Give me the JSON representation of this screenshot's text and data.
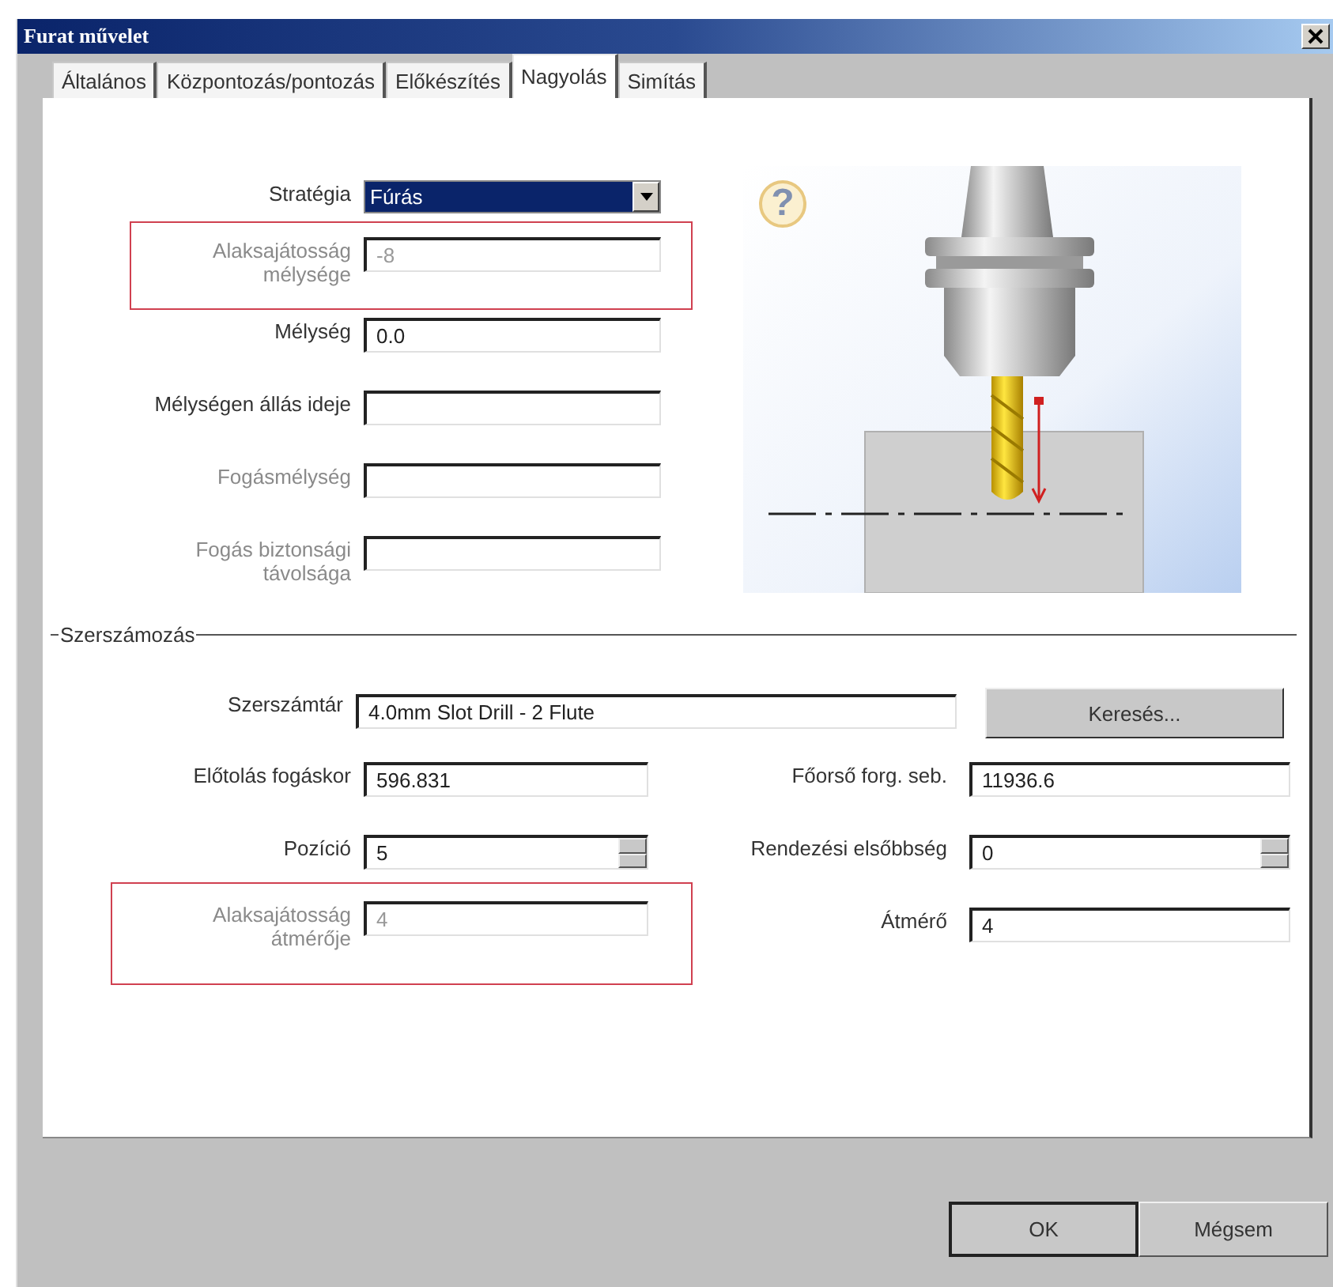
{
  "window": {
    "title": "Furat művelet"
  },
  "tabs": [
    {
      "label": "Általános",
      "selected": false
    },
    {
      "label": "Központozás/pontozás",
      "selected": false
    },
    {
      "label": "Előkészítés",
      "selected": false
    },
    {
      "label": "Nagyolás",
      "selected": true
    },
    {
      "label": "Simítás",
      "selected": false
    }
  ],
  "help_glyph": "?",
  "fields": [
    {
      "kind": "dropdown",
      "label": "Stratégia",
      "value": "Fúrás",
      "disabled": false,
      "highlighted": false
    },
    {
      "kind": "text",
      "label": "Alaksajátosság\nmélysége",
      "value": "-8",
      "disabled": true,
      "highlighted": true
    },
    {
      "kind": "text",
      "label": "Mélység",
      "value": "0.0",
      "disabled": false,
      "highlighted": false
    },
    {
      "kind": "text",
      "label": "Mélységen állás ideje",
      "disabled": false,
      "highlighted": false
    },
    {
      "kind": "text",
      "label": "Fogásmélység",
      "disabled": true,
      "highlighted": false
    },
    {
      "kind": "text",
      "label": "Fogás biztonsági\ntávolsága",
      "disabled": true,
      "highlighted": false
    }
  ],
  "tooling": {
    "title": "Szerszámozás",
    "library": {
      "label": "Szerszámtár",
      "value": "4.0mm Slot Drill - 2 Flute"
    },
    "search_button": "Keresés...",
    "fields": [
      {
        "kind": "text",
        "label": "Előtolás fogáskor",
        "value": "596.831",
        "disabled": false,
        "highlighted": false
      },
      {
        "kind": "text",
        "label": "Főorső forg. seb.",
        "value": "11936.6",
        "disabled": false,
        "highlighted": false
      },
      {
        "kind": "spin",
        "label": "Pozíció",
        "value": "5",
        "disabled": false,
        "highlighted": false
      },
      {
        "kind": "spin",
        "label": "Rendezési elsőbbség",
        "value": "0",
        "disabled": false,
        "highlighted": false
      },
      {
        "kind": "text",
        "label": "Alaksajátosság\nátmérője",
        "value": "4",
        "disabled": true,
        "highlighted": true
      },
      {
        "kind": "text",
        "label": "Átmérő",
        "value": "4",
        "disabled": false,
        "highlighted": false
      }
    ]
  },
  "buttons": [
    {
      "label": "OK",
      "default": true
    },
    {
      "label": "Mégsem",
      "default": false
    }
  ]
}
